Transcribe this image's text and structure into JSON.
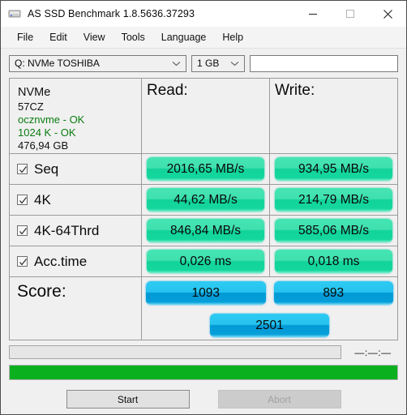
{
  "window": {
    "title": "AS SSD Benchmark 1.8.5636.37293",
    "app_icon": "ssd-drive-icon",
    "controls": {
      "minimize": "minimize-icon",
      "maximize": "maximize-icon",
      "close": "close-icon"
    }
  },
  "menu": {
    "items": [
      "File",
      "Edit",
      "View",
      "Tools",
      "Language",
      "Help"
    ]
  },
  "toolbar": {
    "drive_select": {
      "value": "Q: NVMe TOSHIBA",
      "arrow": "chevron-down-icon"
    },
    "size_select": {
      "value": "1 GB",
      "arrow": "chevron-down-icon"
    },
    "name_field": {
      "value": "",
      "placeholder": ""
    }
  },
  "info": {
    "model": "NVMe",
    "firmware": "57CZ",
    "driver": "ocznvme - OK",
    "alignment": "1024 K - OK",
    "capacity": "476,94 GB"
  },
  "headers": {
    "read": "Read:",
    "write": "Write:"
  },
  "tests": [
    {
      "name": "Seq",
      "checked": true,
      "read": "2016,65 MB/s",
      "write": "934,95 MB/s"
    },
    {
      "name": "4K",
      "checked": true,
      "read": "44,62 MB/s",
      "write": "214,79 MB/s"
    },
    {
      "name": "4K-64Thrd",
      "checked": true,
      "read": "846,84 MB/s",
      "write": "585,06 MB/s"
    },
    {
      "name": "Acc.time",
      "checked": true,
      "read": "0,026 ms",
      "write": "0,018 ms"
    }
  ],
  "score": {
    "label": "Score:",
    "read": "1093",
    "write": "893",
    "total": "2501"
  },
  "status": {
    "message": "",
    "timer": "—:—:—",
    "progress_percent": 100
  },
  "actions": {
    "start": "Start",
    "abort": "Abort"
  },
  "colors": {
    "value_green": "#12d49a",
    "score_blue": "#029ad6",
    "progress_green": "#0bb01f",
    "ok_text_green": "#0a7d10"
  }
}
